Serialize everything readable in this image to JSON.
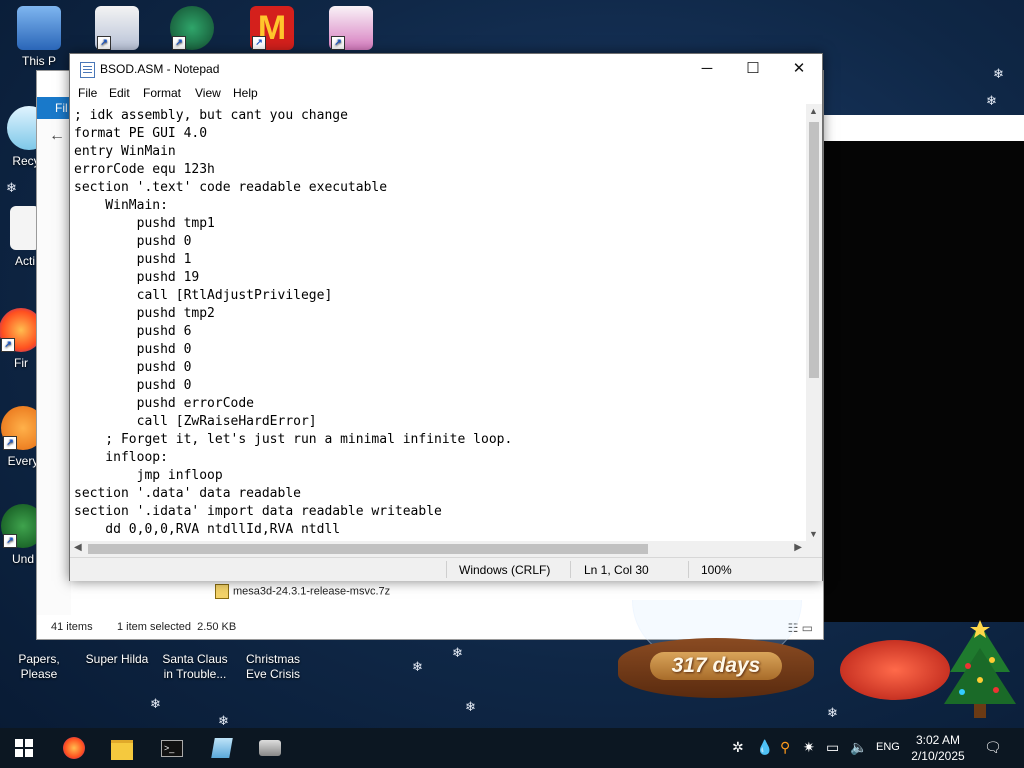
{
  "desktop": {
    "icons": [
      {
        "label": "This PC",
        "visible_label": "This P"
      },
      {
        "label": "Recycle",
        "visible_label": "Recyc"
      },
      {
        "label": "Acti",
        "visible_label": "Acti"
      },
      {
        "label": "Fir",
        "visible_label": "Fir"
      },
      {
        "label": "Every",
        "visible_label": "Every"
      },
      {
        "label": "Und",
        "visible_label": "Und"
      }
    ],
    "bottom_icons": [
      {
        "label": "Papers, Please"
      },
      {
        "label": "Super Hilda"
      },
      {
        "label": "Santa Claus in Trouble..."
      },
      {
        "label": "Christmas Eve Crisis"
      }
    ]
  },
  "explorer": {
    "ribbon_label": "Fil",
    "file_item": "mesa3d-24.3.1-release-msvc.7z",
    "status_items": "41 items",
    "status_selected": "1 item selected  2.50 KB"
  },
  "notepad": {
    "title": "BSOD.ASM - Notepad",
    "menu": [
      "File",
      "Edit",
      "Format",
      "View",
      "Help"
    ],
    "code": "; idk assembly, but cant you change\nformat PE GUI 4.0\nentry WinMain\nerrorCode equ 123h\nsection '.text' code readable executable\n    WinMain:\n        pushd tmp1\n        pushd 0\n        pushd 1\n        pushd 19\n        call [RtlAdjustPrivilege]\n        pushd tmp2\n        pushd 6\n        pushd 0\n        pushd 0\n        pushd 0\n        pushd errorCode\n        call [ZwRaiseHardError]\n    ; Forget it, let's just run a minimal infinite loop.\n    infloop:\n        jmp infloop\nsection '.data' data readable\nsection '.idata' import data readable writeable\n    dd 0,0,0,RVA ntdllId,RVA ntdll",
    "status": {
      "encoding": "Windows (CRLF)",
      "position": "Ln 1, Col 30",
      "zoom": "100%"
    }
  },
  "countdown": {
    "text": "317 days"
  },
  "taskbar": {
    "lang": "ENG",
    "time": "3:02 AM",
    "date": "2/10/2025"
  }
}
